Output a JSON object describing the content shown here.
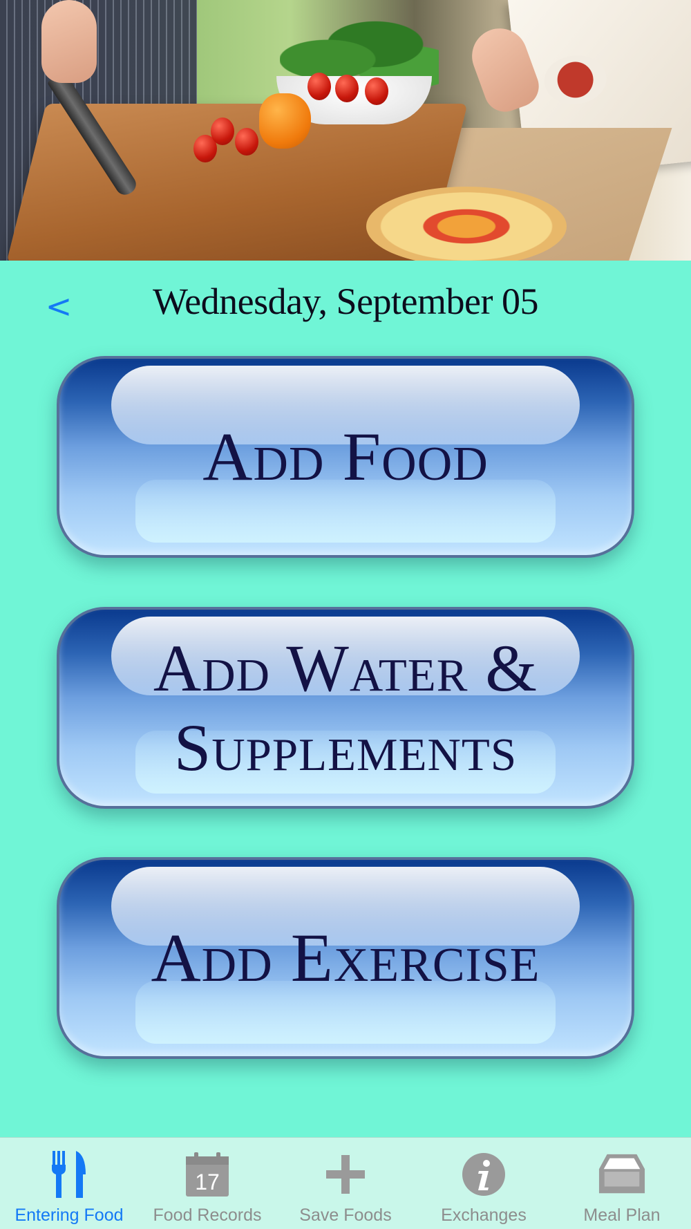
{
  "header": {
    "date": "Wednesday, September 05",
    "back_label": "<"
  },
  "actions": {
    "add_food": "Add Food",
    "add_water": "Add Water & Supplements",
    "add_exercise": "Add Exercise"
  },
  "tabs": [
    {
      "label": "Entering Food",
      "icon": "fork-knife-icon",
      "active": true
    },
    {
      "label": "Food Records",
      "icon": "calendar-icon",
      "calendar_day": "17",
      "active": false
    },
    {
      "label": "Save Foods",
      "icon": "plus-icon",
      "active": false
    },
    {
      "label": "Exchanges",
      "icon": "info-icon",
      "active": false
    },
    {
      "label": "Meal Plan",
      "icon": "tray-icon",
      "active": false
    }
  ],
  "colors": {
    "background": "#70f5d6",
    "tab_active": "#1479f5",
    "tab_inactive": "#8d8d8d",
    "button_text": "#131245"
  }
}
